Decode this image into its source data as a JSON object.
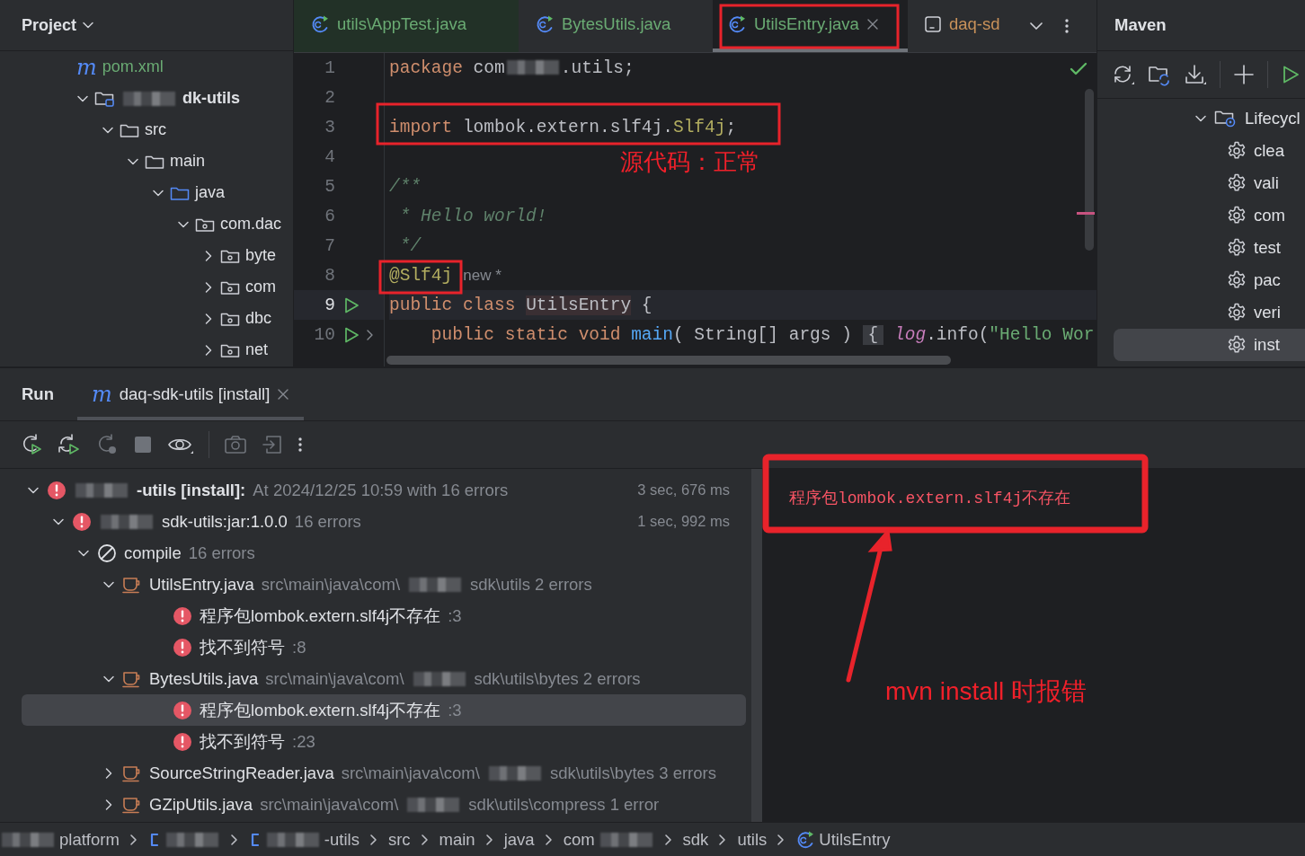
{
  "project_panel": {
    "title": "Project",
    "tree": [
      {
        "label": [
          {
            "t": "pom.xml",
            "kind": "maven"
          }
        ],
        "kind": "maven-file",
        "icon_glyph": "m"
      },
      {
        "label": [
          {
            "kind": "blur"
          },
          {
            "t": "dk-utils",
            "kind": "bold"
          }
        ],
        "kind": "module",
        "expanded": true,
        "children": [
          {
            "label": [
              {
                "t": "src",
                "kind": "plain"
              }
            ],
            "kind": "folder",
            "expanded": true,
            "children": [
              {
                "label": [
                  {
                    "t": "main",
                    "kind": "plain"
                  }
                ],
                "kind": "folder",
                "expanded": true,
                "children": [
                  {
                    "label": [
                      {
                        "t": "java",
                        "kind": "plain"
                      }
                    ],
                    "kind": "source-folder",
                    "expanded": true,
                    "children": [
                      {
                        "label": [
                          {
                            "t": "com.dac",
                            "kind": "plain"
                          }
                        ],
                        "kind": "package",
                        "expanded": true,
                        "children": [
                          {
                            "label": [
                              {
                                "t": "byte",
                                "kind": "plain"
                              }
                            ],
                            "kind": "package",
                            "expanded": false
                          },
                          {
                            "label": [
                              {
                                "t": "com",
                                "kind": "plain"
                              }
                            ],
                            "kind": "package",
                            "expanded": false
                          },
                          {
                            "label": [
                              {
                                "t": "dbc",
                                "kind": "plain"
                              }
                            ],
                            "kind": "package",
                            "expanded": false
                          },
                          {
                            "label": [
                              {
                                "t": "net",
                                "kind": "plain"
                              }
                            ],
                            "kind": "package",
                            "expanded": false
                          }
                        ]
                      }
                    ]
                  }
                ]
              }
            ]
          }
        ]
      }
    ]
  },
  "editor": {
    "tabs": [
      {
        "label": "utils\\AppTest.java",
        "kind": "test-class",
        "color": "#6aab73",
        "selected": false
      },
      {
        "label": "BytesUtils.java",
        "kind": "class",
        "color": "#6aab73",
        "selected": false
      },
      {
        "label": "UtilsEntry.java",
        "kind": "class",
        "color": "#6aab73",
        "selected": true
      },
      {
        "label": "daq-sd",
        "kind": "console",
        "color": "#c9925a",
        "selected": false
      }
    ],
    "lines": [
      {
        "n": "1",
        "current": false,
        "runnable": false,
        "foldable": false,
        "tokens": [
          {
            "t": "package",
            "kind": "kw"
          },
          {
            "t": " com",
            "kind": "plain"
          },
          {
            "kind": "blur"
          },
          {
            "t": ".utils;",
            "kind": "plain"
          }
        ]
      },
      {
        "n": "2",
        "current": false,
        "runnable": false,
        "foldable": false
      },
      {
        "n": "3",
        "current": false,
        "runnable": false,
        "foldable": false,
        "tokens": [
          {
            "t": "import",
            "kind": "kw"
          },
          {
            "t": " lombok.extern.slf4j.",
            "kind": "plain"
          },
          {
            "t": "Slf4j",
            "kind": "ann"
          },
          {
            "t": ";",
            "kind": "plain"
          }
        ]
      },
      {
        "n": "4",
        "current": false,
        "runnable": false,
        "foldable": false
      },
      {
        "n": "5",
        "current": false,
        "runnable": false,
        "foldable": false,
        "tokens": [
          {
            "t": "/**",
            "kind": "doc"
          }
        ]
      },
      {
        "n": "6",
        "current": false,
        "runnable": false,
        "foldable": false,
        "tokens": [
          {
            "t": " * Hello world!",
            "kind": "doc"
          }
        ]
      },
      {
        "n": "7",
        "current": false,
        "runnable": false,
        "foldable": false,
        "tokens": [
          {
            "t": " */",
            "kind": "doc"
          }
        ]
      },
      {
        "n": "8",
        "current": false,
        "runnable": false,
        "foldable": false,
        "tokens": [
          {
            "t": "@Slf4j",
            "kind": "ann"
          },
          {
            "t": "new *",
            "kind": "hint"
          }
        ]
      },
      {
        "n": "9",
        "current": true,
        "runnable": true,
        "foldable": false,
        "tokens": [
          {
            "t": "public class ",
            "kind": "kw"
          },
          {
            "t": "UtilsEntry",
            "kind": "cls"
          },
          {
            "t": " {",
            "kind": "plain"
          }
        ]
      },
      {
        "n": "10",
        "current": false,
        "runnable": true,
        "foldable": true,
        "tokens": [
          {
            "t": "    public static void ",
            "kind": "kw"
          },
          {
            "t": "main",
            "kind": "fn"
          },
          {
            "t": "( String[] args ) ",
            "kind": "plain"
          },
          {
            "t": "{",
            "kind": "fold"
          },
          {
            "t": " log",
            "kind": "field"
          },
          {
            "t": ".info(",
            "kind": "plain"
          },
          {
            "t": "\"Hello Wor",
            "kind": "str"
          }
        ]
      }
    ]
  },
  "maven": {
    "title": "Maven",
    "tree": [
      {
        "label": "Lifecycl",
        "kind": "lifecycle",
        "expanded": true,
        "selected": false,
        "children": [
          {
            "label": "clea",
            "kind": "goal",
            "selected": false
          },
          {
            "label": "vali",
            "kind": "goal",
            "selected": false
          },
          {
            "label": "com",
            "kind": "goal",
            "selected": false
          },
          {
            "label": "test",
            "kind": "goal",
            "selected": false
          },
          {
            "label": "pac",
            "kind": "goal",
            "selected": false
          },
          {
            "label": "veri",
            "kind": "goal",
            "selected": false
          },
          {
            "label": "inst",
            "kind": "goal",
            "selected": true
          }
        ]
      }
    ]
  },
  "run": {
    "title": "Run",
    "tab": {
      "icon_glyph": "m",
      "label": "daq-sdk-utils [install]"
    },
    "tree": [
      {
        "kind": "error",
        "expanded": true,
        "selected": false,
        "label": [
          {
            "kind": "blur"
          },
          {
            "t": "-utils [install]:",
            "kind": "bold"
          },
          {
            "t": " At 2024/12/25 10:59 with 16 errors",
            "kind": "dim"
          }
        ],
        "duration": "3 sec, 676 ms",
        "children": [
          {
            "kind": "error",
            "expanded": true,
            "selected": false,
            "label": [
              {
                "kind": "blur"
              },
              {
                "t": "sdk-utils:jar:1.0.0",
                "kind": "plain"
              },
              {
                "t": "  16 errors",
                "kind": "dim"
              }
            ],
            "duration": "1 sec, 992 ms",
            "children": [
              {
                "kind": "compile",
                "expanded": true,
                "selected": false,
                "label": [
                  {
                    "t": "compile",
                    "kind": "plain"
                  },
                  {
                    "t": "  16 errors",
                    "kind": "dim"
                  }
                ],
                "children": [
                  {
                    "kind": "java-file",
                    "expanded": true,
                    "selected": false,
                    "label": [
                      {
                        "t": "UtilsEntry.java",
                        "kind": "plain"
                      },
                      {
                        "t": " src\\main\\java\\com\\",
                        "kind": "dim"
                      },
                      {
                        "kind": "blur"
                      },
                      {
                        "t": "sdk\\utils 2 errors",
                        "kind": "dim"
                      }
                    ],
                    "children": [
                      {
                        "kind": "message",
                        "selected": false,
                        "label": [
                          {
                            "t": "程序包lombok.extern.slf4j不存在",
                            "kind": "plain"
                          },
                          {
                            "t": " :3",
                            "kind": "dim"
                          }
                        ]
                      },
                      {
                        "kind": "message",
                        "selected": false,
                        "label": [
                          {
                            "t": "找不到符号",
                            "kind": "plain"
                          },
                          {
                            "t": " :8",
                            "kind": "dim"
                          }
                        ]
                      }
                    ]
                  },
                  {
                    "kind": "java-file",
                    "expanded": true,
                    "selected": false,
                    "label": [
                      {
                        "t": "BytesUtils.java",
                        "kind": "plain"
                      },
                      {
                        "t": " src\\main\\java\\com\\",
                        "kind": "dim"
                      },
                      {
                        "kind": "blur"
                      },
                      {
                        "t": "sdk\\utils\\bytes 2 errors",
                        "kind": "dim"
                      }
                    ],
                    "children": [
                      {
                        "kind": "message",
                        "selected": true,
                        "label": [
                          {
                            "t": "程序包lombok.extern.slf4j不存在",
                            "kind": "plain"
                          },
                          {
                            "t": " :3",
                            "kind": "dim"
                          }
                        ]
                      },
                      {
                        "kind": "message",
                        "selected": false,
                        "label": [
                          {
                            "t": "找不到符号",
                            "kind": "plain"
                          },
                          {
                            "t": " :23",
                            "kind": "dim"
                          }
                        ]
                      }
                    ]
                  },
                  {
                    "kind": "java-file",
                    "expanded": false,
                    "selected": false,
                    "label": [
                      {
                        "t": "SourceStringReader.java",
                        "kind": "plain"
                      },
                      {
                        "t": " src\\main\\java\\com\\",
                        "kind": "dim"
                      },
                      {
                        "kind": "blur"
                      },
                      {
                        "t": "sdk\\utils\\bytes 3 errors",
                        "kind": "dim"
                      }
                    ]
                  },
                  {
                    "kind": "java-file",
                    "expanded": false,
                    "selected": false,
                    "label": [
                      {
                        "t": "GZipUtils.java",
                        "kind": "plain"
                      },
                      {
                        "t": " src\\main\\java\\com\\",
                        "kind": "dim"
                      },
                      {
                        "kind": "blur"
                      },
                      {
                        "t": "sdk\\utils\\compress 1 error",
                        "kind": "dim"
                      }
                    ]
                  }
                ]
              }
            ]
          }
        ]
      }
    ],
    "console": {
      "text": "程序包lombok.extern.slf4j不存在"
    }
  },
  "status_bar": {
    "breadcrumbs": [
      {
        "kind": "folder",
        "parts": [
          {
            "kind": "blur"
          },
          {
            "t": "platform",
            "kind": "plain"
          }
        ]
      },
      {
        "kind": "module",
        "parts": [
          {
            "kind": "blur"
          }
        ]
      },
      {
        "kind": "module",
        "parts": [
          {
            "kind": "blur"
          },
          {
            "t": "-utils",
            "kind": "plain"
          }
        ]
      },
      {
        "kind": "folder",
        "parts": [
          {
            "t": "src",
            "kind": "plain"
          }
        ]
      },
      {
        "kind": "folder",
        "parts": [
          {
            "t": "main",
            "kind": "plain"
          }
        ]
      },
      {
        "kind": "folder",
        "parts": [
          {
            "t": "java",
            "kind": "plain"
          }
        ]
      },
      {
        "kind": "folder",
        "parts": [
          {
            "t": "com",
            "kind": "plain"
          },
          {
            "kind": "blur"
          }
        ]
      },
      {
        "kind": "folder",
        "parts": [
          {
            "t": "sdk",
            "kind": "plain"
          }
        ]
      },
      {
        "kind": "folder",
        "parts": [
          {
            "t": "utils",
            "kind": "plain"
          }
        ]
      },
      {
        "kind": "class",
        "parts": [
          {
            "t": "UtilsEntry",
            "kind": "plain"
          }
        ]
      }
    ]
  },
  "annotations": {
    "notes": [
      {
        "kind": "code-ok",
        "text": "源代码：正常"
      },
      {
        "kind": "install-error",
        "text": "mvn install 时报错"
      }
    ]
  }
}
